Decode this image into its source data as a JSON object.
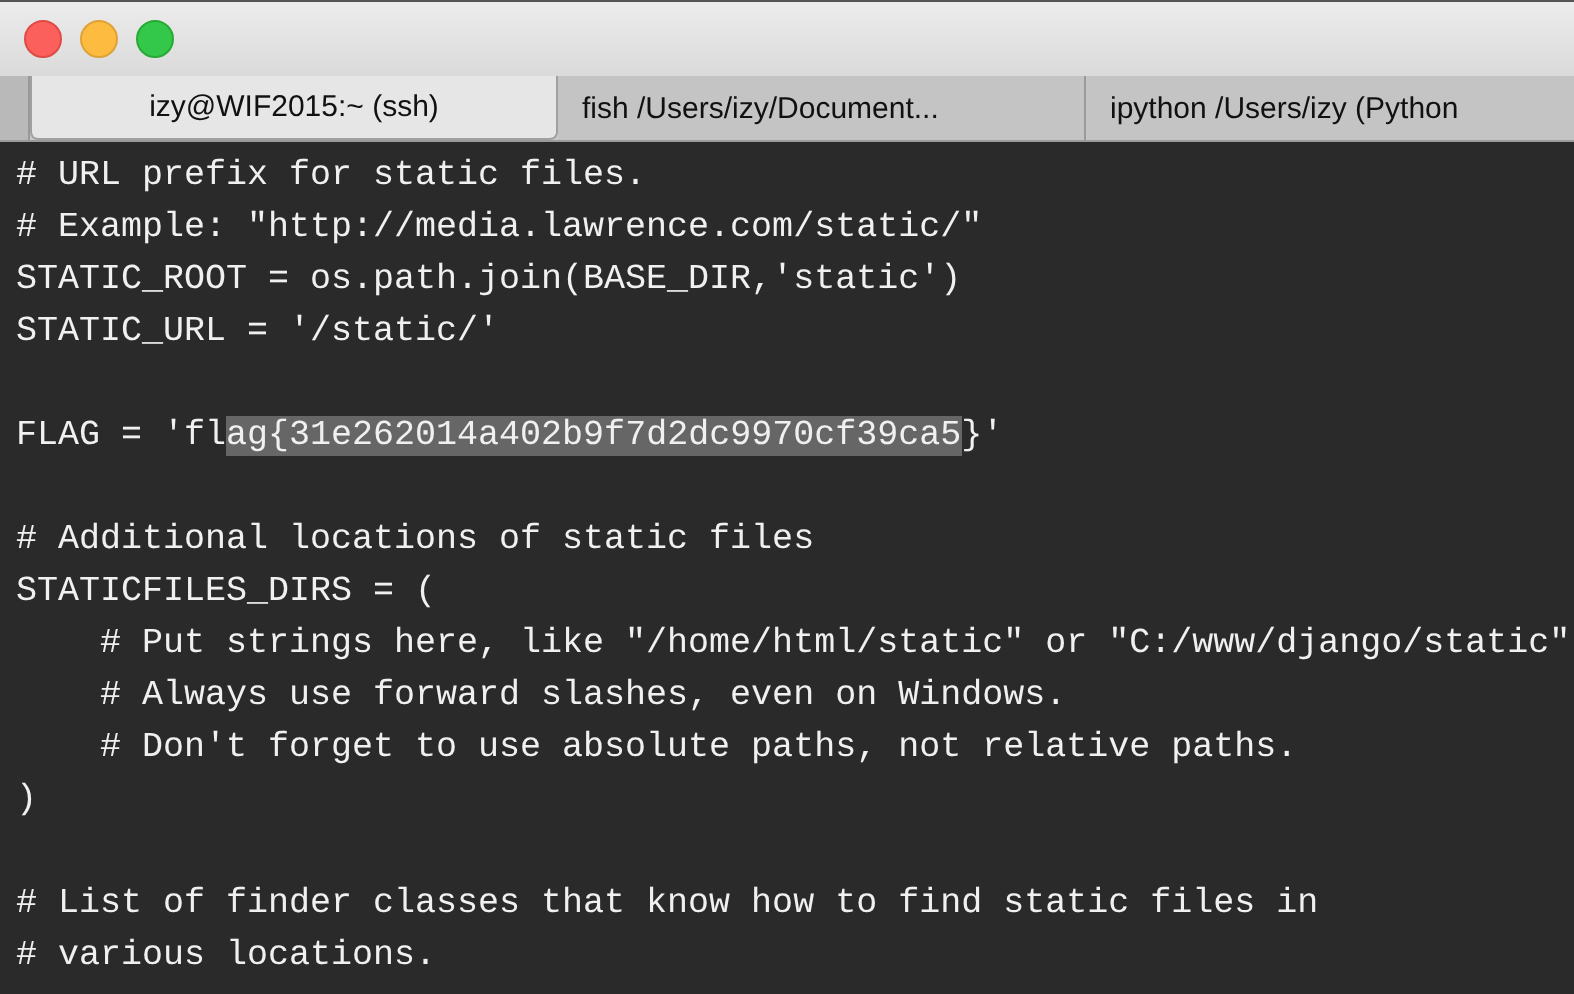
{
  "window": {
    "buttons": [
      {
        "kind": "close"
      },
      {
        "kind": "minimize"
      },
      {
        "kind": "zoom"
      }
    ]
  },
  "tabs": [
    {
      "label": "izy@WIF2015:~ (ssh)",
      "selected": true
    },
    {
      "label": "fish  /Users/izy/Document...",
      "selected": false
    },
    {
      "label": "ipython  /Users/izy (Python",
      "selected": false
    }
  ],
  "terminal": {
    "blocks": [
      {
        "lines": [
          {
            "segments": [
              {
                "text": "# URL prefix for static files.",
                "selected": false
              }
            ]
          },
          {
            "segments": [
              {
                "text": "# Example: \"http://media.lawrence.com/static/\"",
                "selected": false
              }
            ]
          },
          {
            "segments": [
              {
                "text": "STATIC_ROOT = os.path.join(BASE_DIR,'static')",
                "selected": false
              }
            ]
          },
          {
            "segments": [
              {
                "text": "STATIC_URL = '/static/'",
                "selected": false
              }
            ]
          }
        ]
      },
      {
        "lines": [
          {
            "segments": [
              {
                "text": "FLAG = 'fl",
                "selected": false
              },
              {
                "text": "ag{31e262014a402b9f7d2dc9970cf39ca5",
                "selected": true
              },
              {
                "text": "}'",
                "selected": false
              }
            ]
          }
        ]
      },
      {
        "lines": [
          {
            "segments": [
              {
                "text": "# Additional locations of static files",
                "selected": false
              }
            ]
          },
          {
            "segments": [
              {
                "text": "STATICFILES_DIRS = (",
                "selected": false
              }
            ]
          },
          {
            "segments": [
              {
                "text": "    # Put strings here, like \"/home/html/static\" or \"C:/www/django/static\"",
                "selected": false
              }
            ]
          },
          {
            "segments": [
              {
                "text": "    # Always use forward slashes, even on Windows.",
                "selected": false
              }
            ]
          },
          {
            "segments": [
              {
                "text": "    # Don't forget to use absolute paths, not relative paths.",
                "selected": false
              }
            ]
          },
          {
            "segments": [
              {
                "text": ")",
                "selected": false
              }
            ]
          }
        ]
      },
      {
        "lines": [
          {
            "segments": [
              {
                "text": "# List of finder classes that know how to find static files in",
                "selected": false
              }
            ]
          },
          {
            "segments": [
              {
                "text": "# various locations.",
                "selected": false
              }
            ]
          }
        ]
      }
    ]
  }
}
